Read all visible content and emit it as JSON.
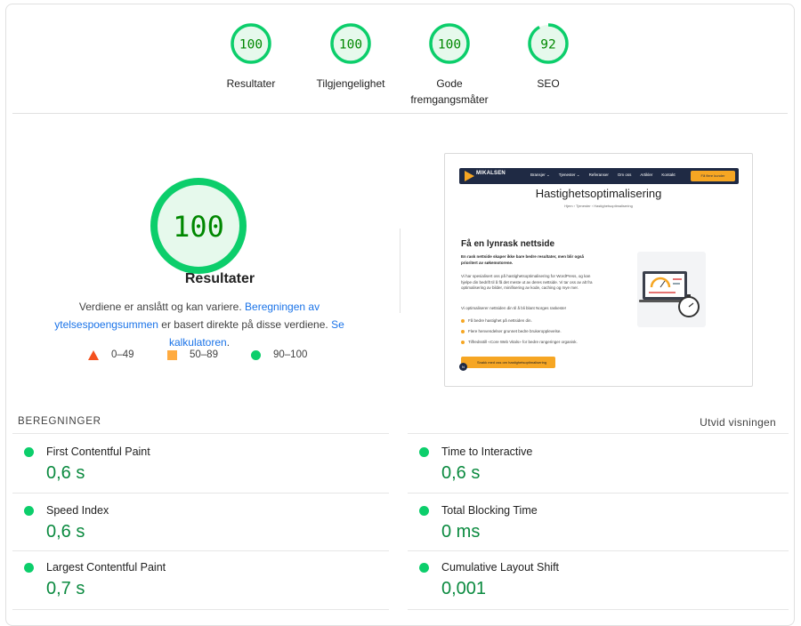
{
  "gauges": [
    {
      "score": "100",
      "label": "Resultater",
      "fraction": 1.0
    },
    {
      "score": "100",
      "label": "Tilgjengelighet",
      "fraction": 1.0
    },
    {
      "score": "100",
      "label_line1": "Gode",
      "label_line2": "fremgangsmåter",
      "fraction": 1.0
    },
    {
      "score": "92",
      "label": "SEO",
      "fraction": 0.92
    }
  ],
  "performance": {
    "score": "100",
    "fraction": 1.0,
    "title": "Resultater",
    "desc_prefix": "Verdiene er anslått og kan variere. ",
    "link1": "Beregningen av ytelsespoengsummen",
    "desc_mid": " er basert direkte på disse verdiene. ",
    "link2": "Se kalkulatoren",
    "desc_suffix": "."
  },
  "legend": {
    "fail": "0–49",
    "average": "50–89",
    "pass": "90–100"
  },
  "preview": {
    "logo_text": "MIKALSEN",
    "menu": [
      "Bransjer ⌄",
      "Tjenester ⌄",
      "Referanser",
      "Om oss",
      "Artikler",
      "Kontakt"
    ],
    "cta": "Få flere kunder",
    "heading": "Hastighetsoptimalisering",
    "breadcrumb": "Hjem  ›  Tjenester  ›  Hastighetsoptimalisering",
    "h2": "Få en lynrask nettside",
    "intro": "En rask nettside skaper ikke bare bedre resultater, men blir også prioritert av søkemotorene.",
    "para1": "Vi har spesialisert oss på hastighetsoptimalisering for WordPress, og kan hjelpe din bedrift til å få det meste ut av deres nettside. Vi tar oss av alt fra optimalisering av bilder, minifisering av kode, caching og mye mer.",
    "para2": "Vi optimaliserer nettsiden din til å bli blant Norges raskeste!",
    "bullets": [
      "Få bedre hastighet på nettsiden din.",
      "Flere henvendelser grunnet bedre brukeropplevelse.",
      "Tilfredsstill «Core Web Vitals» for bedre rangeringer organisk."
    ],
    "button": "Snakk med oss om hastighetsoptimalisering",
    "badge": "N"
  },
  "metrics": {
    "heading": "BEREGNINGER",
    "expand": "Utvid visningen",
    "items": [
      {
        "name": "First Contentful Paint",
        "value": "0,6 s"
      },
      {
        "name": "Time to Interactive",
        "value": "0,6 s"
      },
      {
        "name": "Speed Index",
        "value": "0,6 s"
      },
      {
        "name": "Total Blocking Time",
        "value": "0 ms"
      },
      {
        "name": "Largest Contentful Paint",
        "value": "0,7 s"
      },
      {
        "name": "Cumulative Layout Shift",
        "value": "0,001"
      }
    ]
  },
  "colors": {
    "pass": "#0cce6b",
    "pass_text": "#008800",
    "pass_bg": "#e6f9ec",
    "average": "#ffab40",
    "fail": "#f4511e",
    "link": "#1a73e8"
  }
}
